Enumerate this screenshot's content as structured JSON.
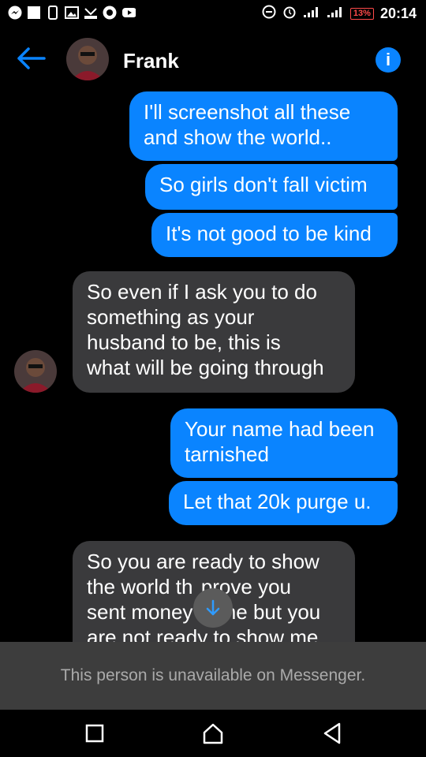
{
  "status_bar": {
    "time": "20:14",
    "battery": "13%",
    "icons": [
      "messenger-icon",
      "square-notification-icon",
      "sim-icon",
      "gallery-icon",
      "missed-call-icon",
      "messenger-round-icon",
      "youtube-icon",
      "do-not-disturb-icon",
      "alarm-icon",
      "wifi-signal-icon",
      "cell-signal-icon",
      "battery-icon"
    ]
  },
  "header": {
    "contact_name": "Frank",
    "back_icon": "back-arrow-icon",
    "info_icon": "info-icon"
  },
  "messages": [
    {
      "dir": "out",
      "text": "I'll screenshot all these\nand show the world.."
    },
    {
      "dir": "out",
      "text": "So girls don't fall victim"
    },
    {
      "dir": "out",
      "text": "It's not good to be kind"
    },
    {
      "dir": "in",
      "text": "So even if I ask you to do\nsomething as your\nhusband to be, this is\nwhat will be going through"
    },
    {
      "dir": "out",
      "text": "Your name had been\ntarnished"
    },
    {
      "dir": "out",
      "text": "Let that 20k purge u."
    },
    {
      "dir": "in",
      "text": "So you are ready to show\nthe world th  prove you\nsent money  me but you\nare not ready to show me"
    }
  ],
  "banner": {
    "text": "This person is unavailable on Messenger."
  },
  "nav": {
    "icons": [
      "recent-apps-icon",
      "home-icon",
      "back-icon"
    ]
  }
}
